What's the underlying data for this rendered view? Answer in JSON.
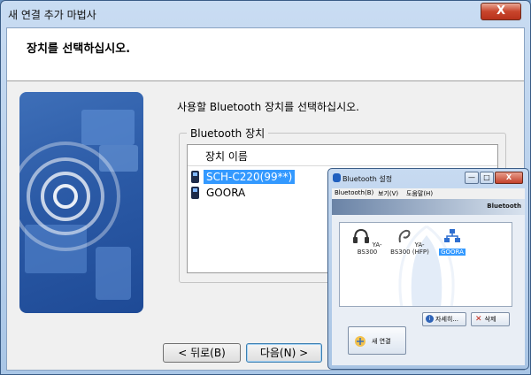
{
  "wizard": {
    "title": "새 연결 추가 마법사",
    "close_glyph": "X",
    "header_title": "장치를 선택하십시오.",
    "instruction": "사용할 Bluetooth 장치를 선택하십시오.",
    "group_label": "Bluetooth 장치",
    "column_header": "장치 이름",
    "devices": [
      {
        "name": "SCH-C220(99**)",
        "icon": "phone-icon",
        "selected": true
      },
      {
        "name": "GOORA",
        "icon": "phone-icon",
        "selected": false
      }
    ],
    "back_label": "< 뒤로(B)",
    "next_label": "다음(N) >"
  },
  "bt_settings": {
    "title": "Bluetooth 설정",
    "minimize_glyph": "—",
    "maximize_glyph": "□",
    "close_glyph": "X",
    "menus": [
      "Bluetooth(B)",
      "보기(V)",
      "도움말(H)"
    ],
    "logo": "Bluetooth",
    "devices": [
      {
        "label": "YA-BS300",
        "icon": "headset-icon",
        "selected": false
      },
      {
        "label": "YA-BS300 (HFP)",
        "icon": "earpiece-icon",
        "selected": false
      },
      {
        "label": "GOORA",
        "icon": "network-icon",
        "selected": true
      }
    ],
    "new_connection_label": "새 연결",
    "details_label": "자세히...",
    "delete_label": "삭제"
  },
  "colors": {
    "accent": "#3399ff",
    "title_bar": "#a9c6e6",
    "close_red": "#c8452c"
  }
}
